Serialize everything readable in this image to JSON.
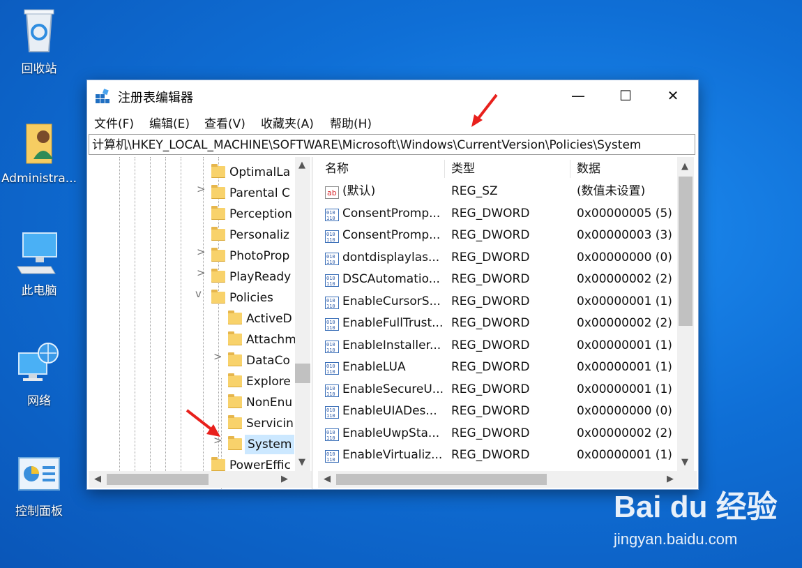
{
  "desktop": {
    "icons": [
      {
        "label": "回收站",
        "icon": "recycle-bin-icon"
      },
      {
        "label": "Administra...",
        "icon": "user-folder-icon"
      },
      {
        "label": "此电脑",
        "icon": "computer-icon"
      },
      {
        "label": "网络",
        "icon": "network-icon"
      },
      {
        "label": "控制面板",
        "icon": "control-panel-icon"
      }
    ]
  },
  "window": {
    "title": "注册表编辑器",
    "buttons": {
      "minimize": "—",
      "maximize": "☐",
      "close": "✕"
    },
    "menu": [
      "文件(F)",
      "编辑(E)",
      "查看(V)",
      "收藏夹(A)",
      "帮助(H)"
    ],
    "address": "计算机\\HKEY_LOCAL_MACHINE\\SOFTWARE\\Microsoft\\Windows\\CurrentVersion\\Policies\\System"
  },
  "tree": {
    "nodes": [
      {
        "label": "OptimalLa",
        "expander": ""
      },
      {
        "label": "Parental C",
        "expander": ">"
      },
      {
        "label": "Perception",
        "expander": ""
      },
      {
        "label": "Personaliz",
        "expander": ""
      },
      {
        "label": "PhotoProp",
        "expander": ">"
      },
      {
        "label": "PlayReady",
        "expander": ">"
      },
      {
        "label": "Policies",
        "expander": "v"
      },
      {
        "label": "ActiveD",
        "expander": ""
      },
      {
        "label": "Attachm",
        "expander": ""
      },
      {
        "label": "DataCo",
        "expander": ">"
      },
      {
        "label": "Explore",
        "expander": ""
      },
      {
        "label": "NonEnu",
        "expander": ""
      },
      {
        "label": "Servicin",
        "expander": ""
      },
      {
        "label": "System",
        "expander": ">",
        "selected": true
      },
      {
        "label": "PowerEffic",
        "expander": ""
      }
    ]
  },
  "list": {
    "columns": [
      "名称",
      "类型",
      "数据"
    ],
    "rows": [
      {
        "name": "(默认)",
        "type": "REG_SZ",
        "data": "(数值未设置)",
        "icon": "string-value-icon"
      },
      {
        "name": "ConsentPromp...",
        "type": "REG_DWORD",
        "data": "0x00000005 (5)",
        "icon": "dword-value-icon"
      },
      {
        "name": "ConsentPromp...",
        "type": "REG_DWORD",
        "data": "0x00000003 (3)",
        "icon": "dword-value-icon"
      },
      {
        "name": "dontdisplaylas...",
        "type": "REG_DWORD",
        "data": "0x00000000 (0)",
        "icon": "dword-value-icon"
      },
      {
        "name": "DSCAutomatio...",
        "type": "REG_DWORD",
        "data": "0x00000002 (2)",
        "icon": "dword-value-icon"
      },
      {
        "name": "EnableCursorS...",
        "type": "REG_DWORD",
        "data": "0x00000001 (1)",
        "icon": "dword-value-icon"
      },
      {
        "name": "EnableFullTrust...",
        "type": "REG_DWORD",
        "data": "0x00000002 (2)",
        "icon": "dword-value-icon"
      },
      {
        "name": "EnableInstaller...",
        "type": "REG_DWORD",
        "data": "0x00000001 (1)",
        "icon": "dword-value-icon"
      },
      {
        "name": "EnableLUA",
        "type": "REG_DWORD",
        "data": "0x00000001 (1)",
        "icon": "dword-value-icon"
      },
      {
        "name": "EnableSecureU...",
        "type": "REG_DWORD",
        "data": "0x00000001 (1)",
        "icon": "dword-value-icon"
      },
      {
        "name": "EnableUIADes...",
        "type": "REG_DWORD",
        "data": "0x00000000 (0)",
        "icon": "dword-value-icon"
      },
      {
        "name": "EnableUwpSta...",
        "type": "REG_DWORD",
        "data": "0x00000002 (2)",
        "icon": "dword-value-icon"
      },
      {
        "name": "EnableVirtualiz...",
        "type": "REG_DWORD",
        "data": "0x00000001 (1)",
        "icon": "dword-value-icon"
      }
    ]
  },
  "watermark": {
    "brand": "Bai du 经验",
    "url": "jingyan.baidu.com"
  }
}
